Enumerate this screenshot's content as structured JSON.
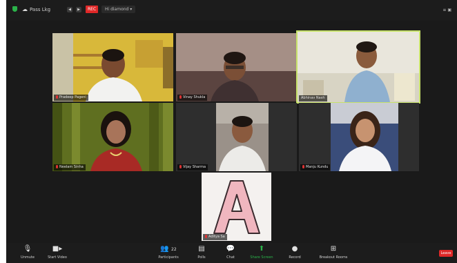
{
  "window": {
    "view_label": "Pass Lkg",
    "rec_badge": "REC",
    "speaker_label": "Hi diamond ▾",
    "view_button": "≡ ▣"
  },
  "participants": [
    {
      "name": "Pradeep Pageni"
    },
    {
      "name": "Vinay Shukla"
    },
    {
      "name": "Abhinav Nash"
    },
    {
      "name": "Neelam Sinha"
    },
    {
      "name": "Vijay Sharma"
    },
    {
      "name": "Manju Kundu"
    },
    {
      "name": "Aditya Sa"
    }
  ],
  "tile7": {
    "letter": "A"
  },
  "toolbar": {
    "mic": {
      "label": "Unmute",
      "icon": "microphone-icon"
    },
    "video": {
      "label": "Start Video",
      "icon": "video-camera-icon"
    },
    "participants": {
      "label": "Participants",
      "count": "22",
      "icon": "participants-icon"
    },
    "chat_a": {
      "label": "Polls",
      "icon": "poll-icon"
    },
    "chat": {
      "label": "Chat",
      "icon": "chat-icon"
    },
    "share": {
      "label": "Share Screen",
      "icon": "share-screen-icon"
    },
    "record": {
      "label": "Record",
      "icon": "record-icon"
    },
    "breakout": {
      "label": "Breakout Rooms",
      "icon": "breakout-rooms-icon"
    },
    "leave": {
      "label": "Leave"
    }
  },
  "colors": {
    "active_speaker_border": "#c7e26a",
    "share_green": "#2bb34a",
    "leave_red": "#e02828",
    "background": "#1a1a1a"
  }
}
